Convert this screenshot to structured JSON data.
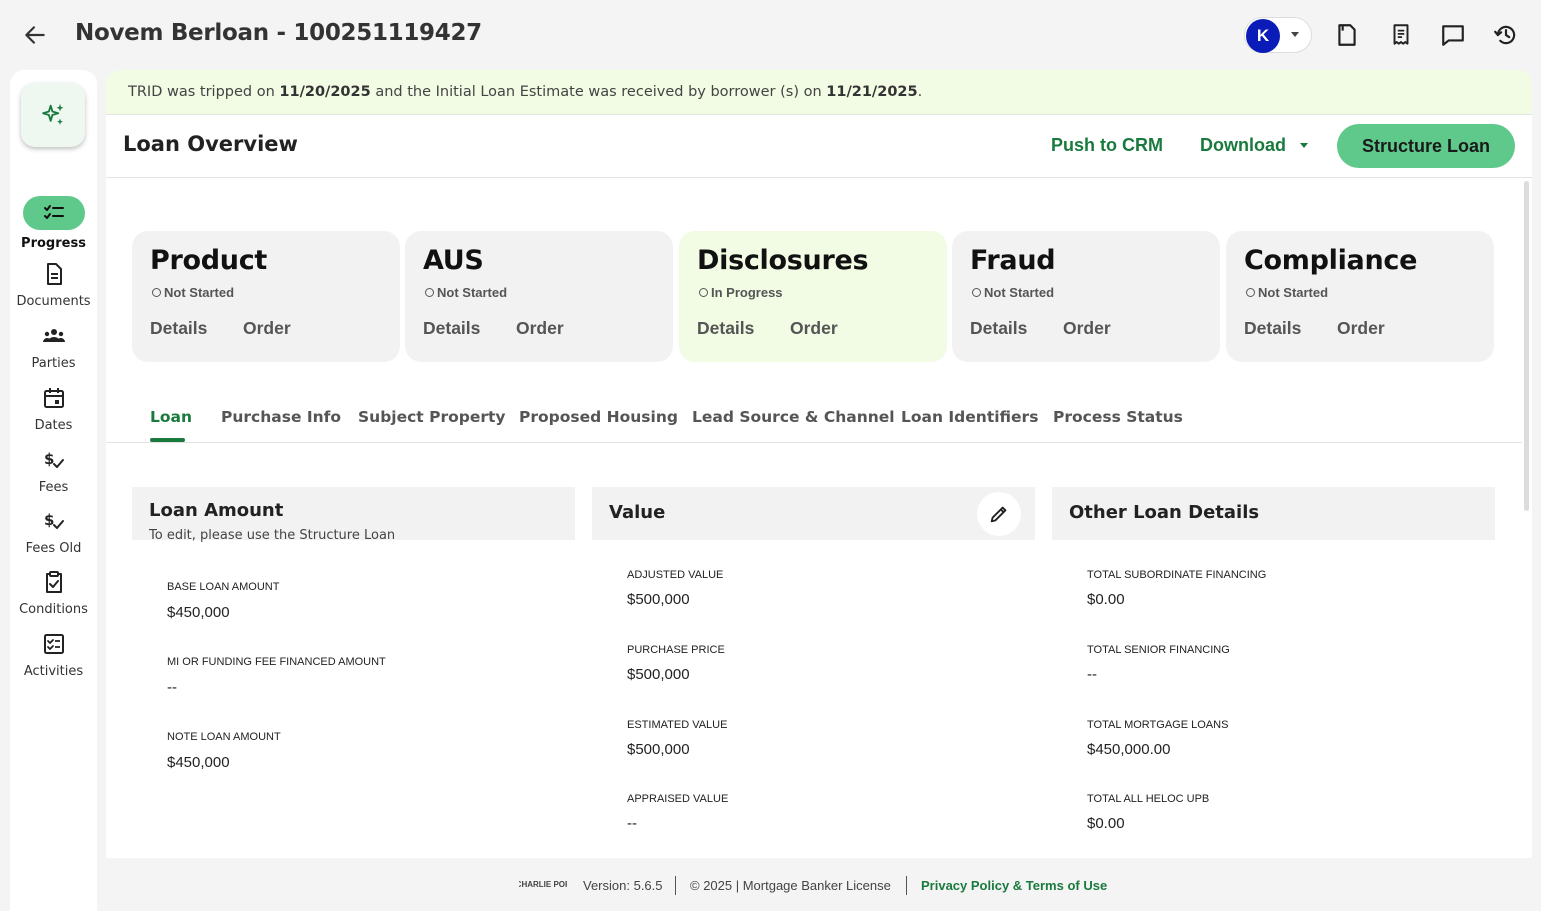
{
  "header": {
    "title": "Novem Berloan - 100251119427",
    "avatar_initial": "K"
  },
  "sidebar": {
    "items": [
      {
        "label": "Progress",
        "icon": "checklist-icon"
      },
      {
        "label": "Documents",
        "icon": "document-icon"
      },
      {
        "label": "Parties",
        "icon": "group-icon"
      },
      {
        "label": "Dates",
        "icon": "calendar-icon"
      },
      {
        "label": "Fees",
        "icon": "dollar-check-icon"
      },
      {
        "label": "Fees Old",
        "icon": "dollar-check-icon"
      },
      {
        "label": "Conditions",
        "icon": "clipboard-check-icon"
      },
      {
        "label": "Activities",
        "icon": "checked-list-icon"
      }
    ]
  },
  "banner": {
    "pre": "TRID was tripped on",
    "date1": "11/20/2025",
    "mid": "and the Initial Loan Estimate was received by borrower (s) on",
    "date2": "11/21/2025",
    "post": "."
  },
  "overview": {
    "title": "Loan Overview",
    "push_label": "Push to CRM",
    "download_label": "Download",
    "structure_label": "Structure Loan"
  },
  "cards": [
    {
      "title": "Product",
      "status": "Not Started",
      "details": "Details",
      "order": "Order"
    },
    {
      "title": "AUS",
      "status": "Not Started",
      "details": "Details",
      "order": "Order"
    },
    {
      "title": "Disclosures",
      "status": "In Progress",
      "details": "Details",
      "order": "Order"
    },
    {
      "title": "Fraud",
      "status": "Not Started",
      "details": "Details",
      "order": "Order"
    },
    {
      "title": "Compliance",
      "status": "Not Started",
      "details": "Details",
      "order": "Order"
    }
  ],
  "tabs": [
    "Loan",
    "Purchase Info",
    "Subject Property",
    "Proposed Housing",
    "Lead Source & Channel",
    "Loan Identifiers",
    "Process Status"
  ],
  "loan_amount": {
    "title": "Loan Amount",
    "subtitle": "To edit, please use the Structure Loan",
    "fields": [
      {
        "label": "BASE LOAN AMOUNT",
        "value": "$450,000"
      },
      {
        "label": "MI OR FUNDING FEE FINANCED AMOUNT",
        "value": "--"
      },
      {
        "label": "NOTE LOAN AMOUNT",
        "value": "$450,000"
      }
    ]
  },
  "value_section": {
    "title": "Value",
    "fields": [
      {
        "label": "ADJUSTED VALUE",
        "value": "$500,000"
      },
      {
        "label": "PURCHASE PRICE",
        "value": "$500,000"
      },
      {
        "label": "ESTIMATED VALUE",
        "value": "$500,000"
      },
      {
        "label": "APPRAISED VALUE",
        "value": "--"
      }
    ]
  },
  "other_details": {
    "title": "Other Loan Details",
    "fields": [
      {
        "label": "TOTAL SUBORDINATE FINANCING",
        "value": "$0.00"
      },
      {
        "label": "TOTAL SENIOR FINANCING",
        "value": "--"
      },
      {
        "label": "TOTAL MORTGAGE LOANS",
        "value": "$450,000.00"
      },
      {
        "label": "TOTAL ALL HELOC UPB",
        "value": "$0.00"
      }
    ]
  },
  "footer": {
    "logo_text": "CHARLIE POP",
    "version": "Version: 5.6.5",
    "copyright": "© 2025 | Mortgage Banker License",
    "privacy": "Privacy Policy & Terms of Use"
  },
  "colors": {
    "accent_green": "#1a7a3e",
    "button_green": "#5ec98a",
    "banner_bg": "#f2fbe3",
    "avatar_blue": "#0b1bb8"
  }
}
